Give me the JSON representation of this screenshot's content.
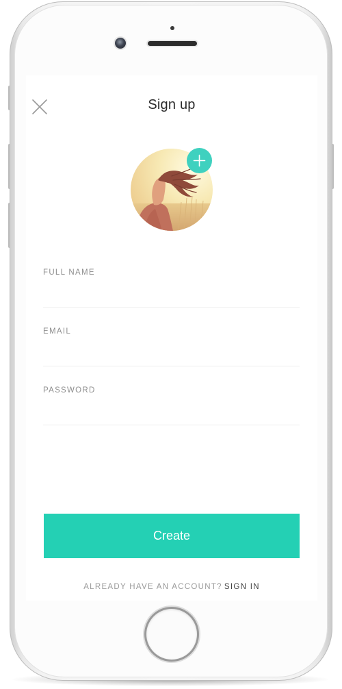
{
  "header": {
    "title": "Sign up",
    "close_icon": "close-icon"
  },
  "avatar": {
    "add_icon": "plus-icon",
    "description_icon": "profile-photo"
  },
  "form": {
    "full_name": {
      "label": "FULL NAME",
      "value": "",
      "placeholder": ""
    },
    "email": {
      "label": "EMAIL",
      "value": "",
      "placeholder": ""
    },
    "password": {
      "label": "PASSWORD",
      "value": "",
      "placeholder": ""
    }
  },
  "actions": {
    "create_label": "Create"
  },
  "footer": {
    "prompt": "ALREADY HAVE AN ACCOUNT?",
    "signin_label": "SIGN IN"
  },
  "colors": {
    "accent": "#24d0b4",
    "accent_badge": "#3fd1bf",
    "title_text": "#2a2a2a",
    "label_text": "#8e8e8e"
  }
}
